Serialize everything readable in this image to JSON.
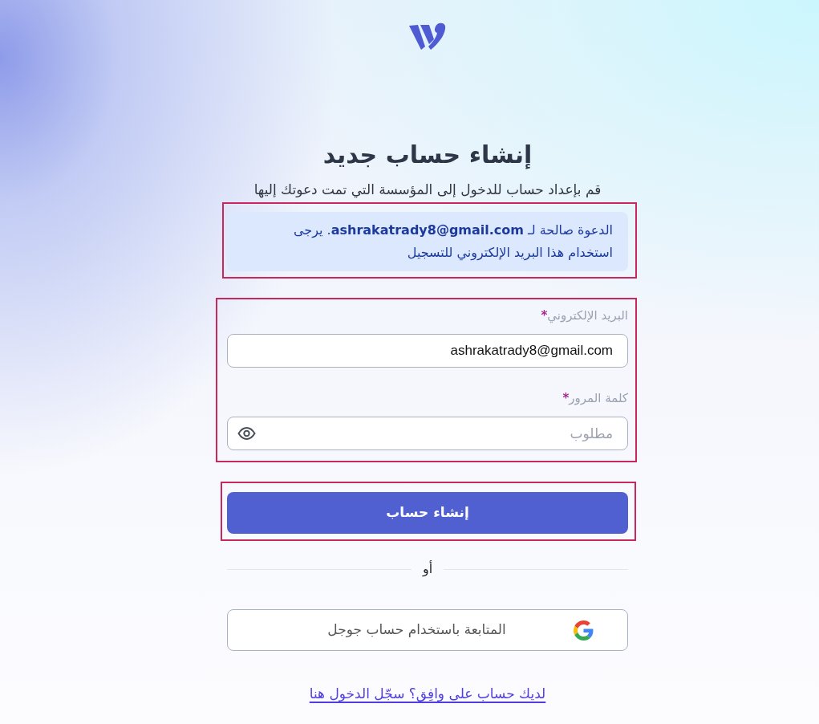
{
  "heading": {
    "title": "إنشاء حساب جديد",
    "subtitle": "قم بإعداد حساب للدخول إلى المؤسسة التي تمت دعوتك إليها"
  },
  "notice": {
    "text": "الدعوة صالحة لـ **ashrakatrady8@gmail.com**. يرجى استخدام هذا البريد الإلكتروني للتسجيل",
    "highlighted": true
  },
  "form": {
    "highlighted": true,
    "fields": [
      {
        "kind": "email",
        "label": "البريد الإلكتروني",
        "required_mark": "*",
        "value": "ashrakatrady8@gmail.com"
      },
      {
        "kind": "password",
        "label": "كلمة المرور",
        "required_mark": "*",
        "placeholder": "مطلوب"
      }
    ]
  },
  "submit_button": {
    "label": "إنشاء حساب",
    "highlighted": true
  },
  "divider": {
    "label": "أو"
  },
  "google_button": {
    "label": "المتابعة باستخدام حساب جوجل"
  },
  "login_link": {
    "label": "لديك حساب على وافِق؟ سجّل الدخول هنا"
  }
}
